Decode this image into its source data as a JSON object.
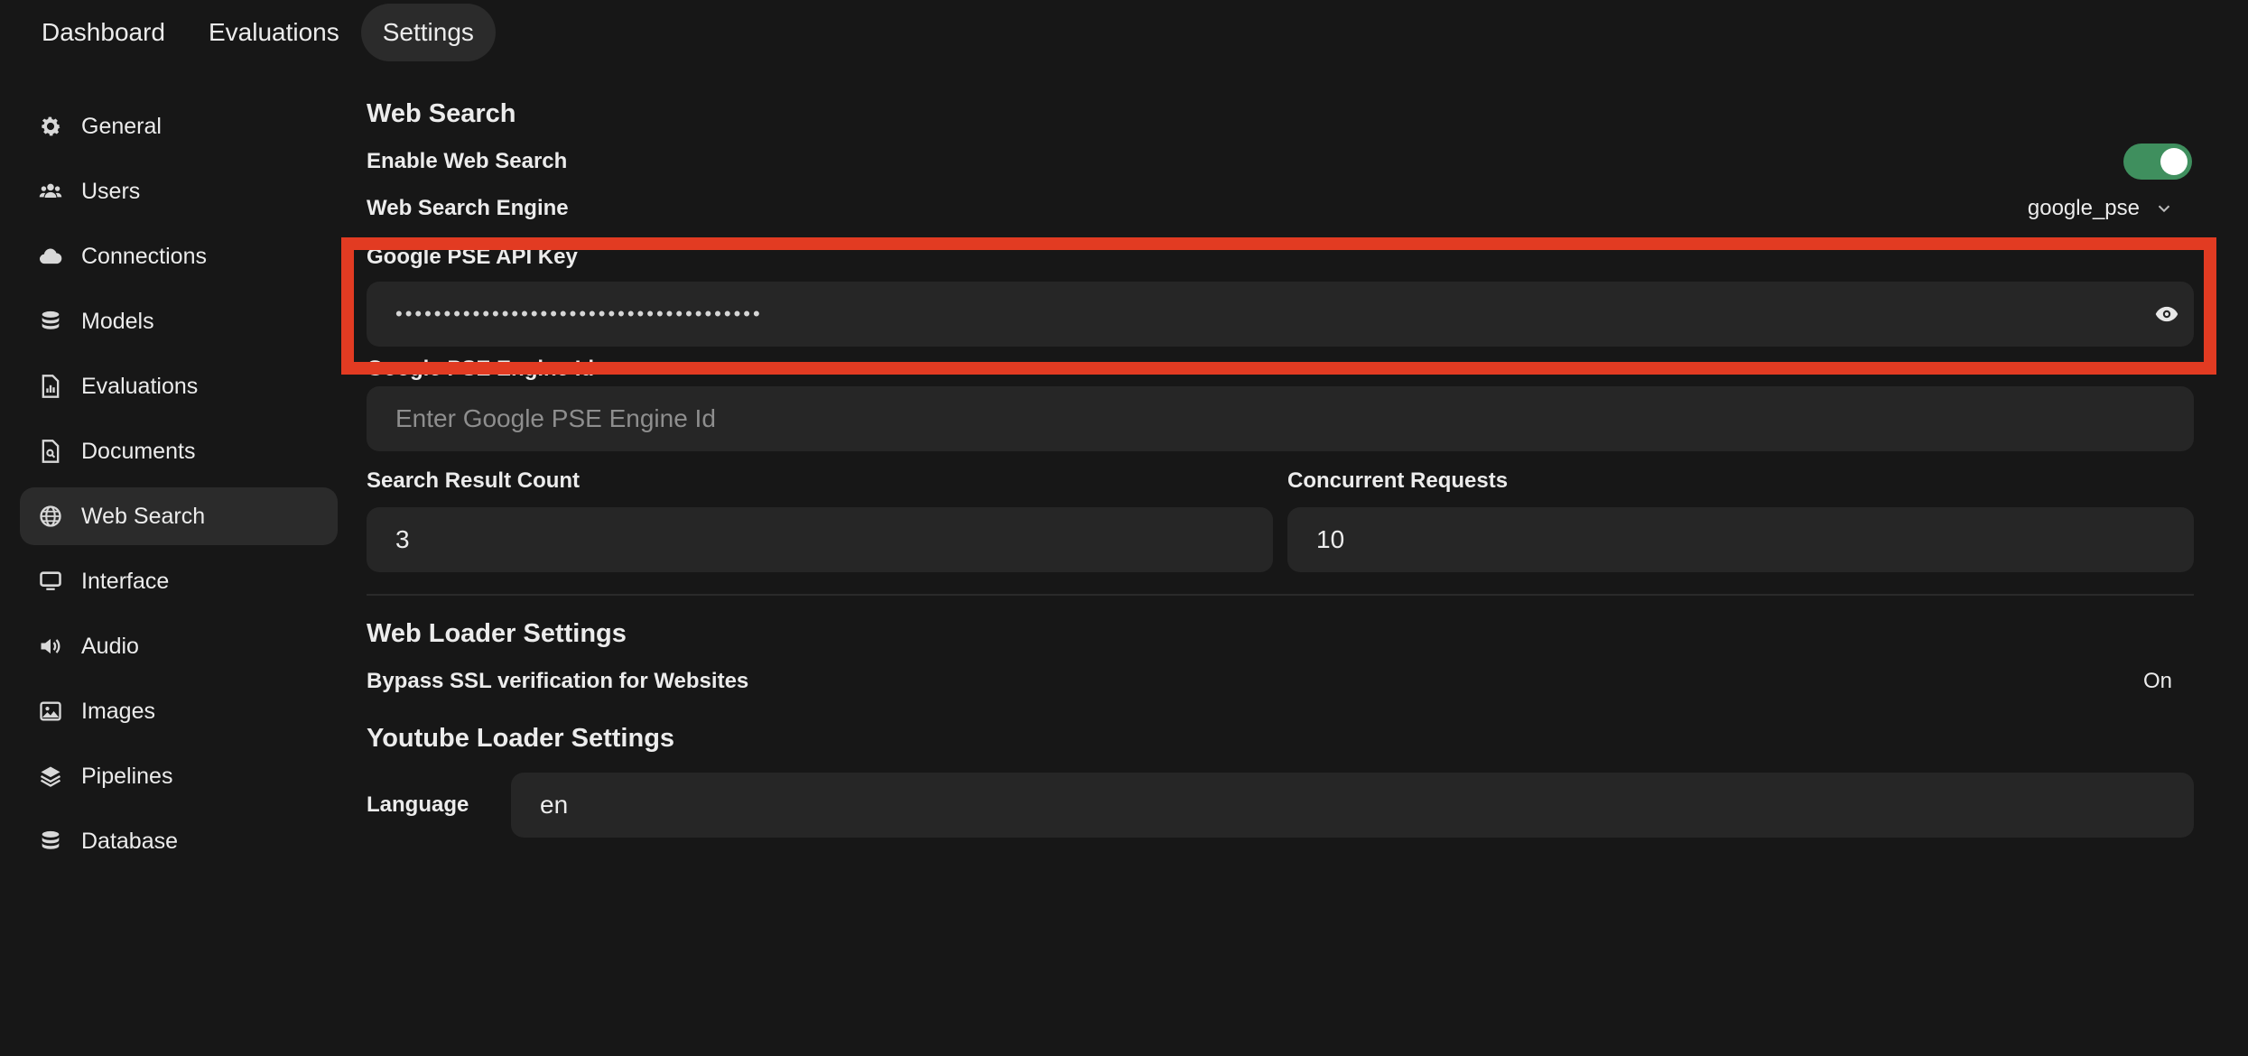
{
  "topnav": {
    "tabs": [
      {
        "label": "Dashboard",
        "active": false
      },
      {
        "label": "Evaluations",
        "active": false
      },
      {
        "label": "Settings",
        "active": true
      }
    ]
  },
  "sidebar": {
    "items": [
      {
        "label": "General",
        "icon": "gear-icon"
      },
      {
        "label": "Users",
        "icon": "users-icon"
      },
      {
        "label": "Connections",
        "icon": "cloud-icon"
      },
      {
        "label": "Models",
        "icon": "database-icon"
      },
      {
        "label": "Evaluations",
        "icon": "document-chart-icon"
      },
      {
        "label": "Documents",
        "icon": "document-search-icon"
      },
      {
        "label": "Web Search",
        "icon": "globe-icon",
        "active": true
      },
      {
        "label": "Interface",
        "icon": "monitor-icon"
      },
      {
        "label": "Audio",
        "icon": "speaker-icon"
      },
      {
        "label": "Images",
        "icon": "image-icon"
      },
      {
        "label": "Pipelines",
        "icon": "layers-icon"
      },
      {
        "label": "Database",
        "icon": "database-icon"
      }
    ]
  },
  "web_search": {
    "title": "Web Search",
    "enable_label": "Enable Web Search",
    "enabled": true,
    "engine_label": "Web Search Engine",
    "engine_value": "google_pse",
    "api_key_label": "Google PSE API Key",
    "api_key_masked": "••••••••••••••••••••••••••••••••••••••",
    "engine_id_label": "Google PSE Engine Id",
    "engine_id_placeholder": "Enter Google PSE Engine Id",
    "result_count_label": "Search Result Count",
    "result_count_value": "3",
    "concurrent_label": "Concurrent Requests",
    "concurrent_value": "10"
  },
  "web_loader": {
    "title": "Web Loader Settings",
    "bypass_ssl_label": "Bypass SSL verification for Websites",
    "bypass_ssl_value": "On"
  },
  "youtube_loader": {
    "title": "Youtube Loader Settings",
    "language_label": "Language",
    "language_value": "en"
  },
  "colors": {
    "background": "#171717",
    "panel": "#262626",
    "active": "#2b2b2b",
    "toggle_on": "#3f8f5e",
    "highlight": "#e23b22"
  }
}
